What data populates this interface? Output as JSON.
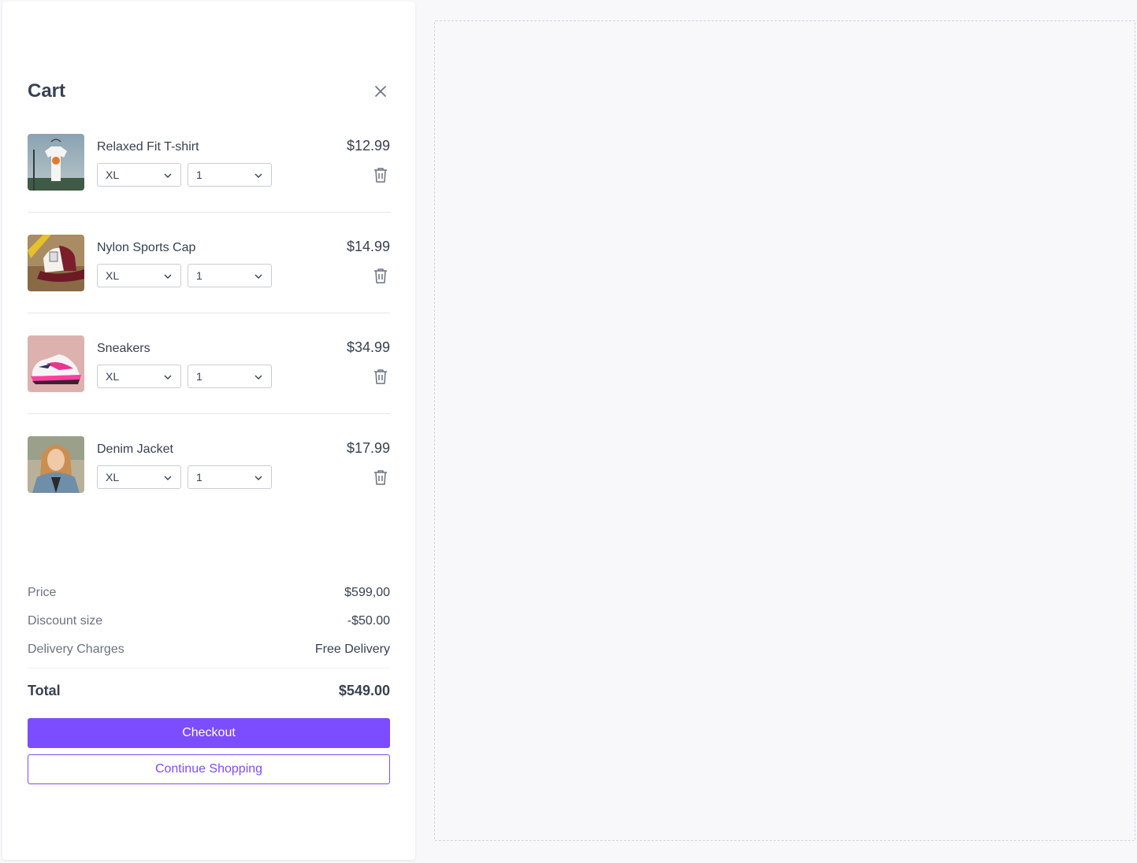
{
  "cart": {
    "title": "Cart",
    "items": [
      {
        "name": "Relaxed Fit T-shirt",
        "price": "$12.99",
        "size": "XL",
        "quantity": "1",
        "image": "tshirt-photo"
      },
      {
        "name": "Nylon Sports Cap",
        "price": "$14.99",
        "size": "XL",
        "quantity": "1",
        "image": "cap-photo"
      },
      {
        "name": "Sneakers",
        "price": "$34.99",
        "size": "XL",
        "quantity": "1",
        "image": "sneakers-photo"
      },
      {
        "name": "Denim Jacket",
        "price": "$17.99",
        "size": "XL",
        "quantity": "1",
        "image": "jacket-photo"
      }
    ],
    "summary": {
      "price_label": "Price",
      "price_value": "$599,00",
      "discount_label": "Discount size",
      "discount_value": "-$50.00",
      "delivery_label": "Delivery Charges",
      "delivery_value": "Free Delivery",
      "total_label": "Total",
      "total_value": "$549.00"
    },
    "checkout_label": "Checkout",
    "continue_label": "Continue Shopping"
  },
  "icons": {
    "close": "close-icon",
    "chevron": "chevron-down-icon",
    "delete": "trash-icon"
  },
  "colors": {
    "accent": "#7c4dff",
    "text": "#374151",
    "muted": "#6b7280",
    "page_bg": "#f8f8fb"
  }
}
